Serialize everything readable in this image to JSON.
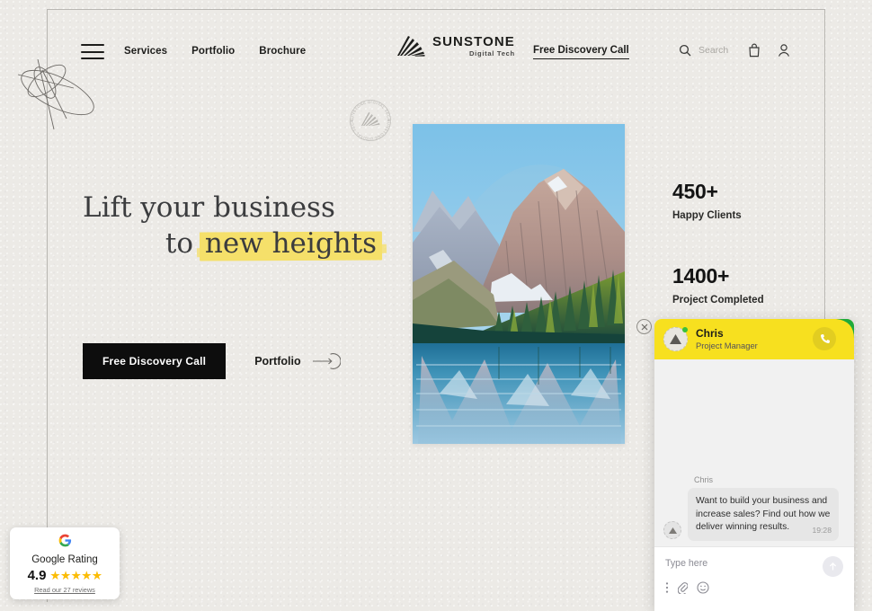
{
  "brand": {
    "name": "SUNSTONE",
    "tagline": "Digital Tech",
    "logo_icon": "sunburst-fan-icon",
    "stamp_text": "SUNSTONE DIGITAL TECH"
  },
  "colors": {
    "background": "#eceae6",
    "accent_yellow": "#f7e01f",
    "highlight_yellow": "#f5e06a",
    "ink": "#1d1d1b",
    "button_black": "#0d0d0d",
    "star_gold": "#fbbc05",
    "online_green": "#3ac13a"
  },
  "header": {
    "menu_icon": "hamburger-menu-icon",
    "nav": [
      {
        "label": "Services"
      },
      {
        "label": "Portfolio"
      },
      {
        "label": "Brochure"
      }
    ],
    "cta_label": "Free Discovery Call",
    "search": {
      "placeholder": "Search",
      "icon": "search-icon"
    },
    "bag_icon": "shopping-bag-icon",
    "account_icon": "user-account-icon"
  },
  "hero": {
    "line1": "Lift your business",
    "line2_prefix": "to ",
    "line2_highlight": "new heights",
    "primary_button": "Free Discovery Call",
    "secondary_link": "Portfolio",
    "secondary_icon": "arrow-right-circle-icon"
  },
  "stats": [
    {
      "value": "450+",
      "label": "Happy Clients"
    },
    {
      "value": "1400+",
      "label": "Project Completed"
    }
  ],
  "photo": {
    "alt": "mountain lake with forest reflection",
    "name": "hero-mountain-lake-photo"
  },
  "google_card": {
    "logo_icon": "google-g-icon",
    "title": "Google Rating",
    "score": "4.9",
    "stars": "★★★★★",
    "reviews_link": "Read our 27 reviews"
  },
  "chat": {
    "close_icon": "close-circle-icon",
    "agent_name": "Chris",
    "agent_role": "Project Manager",
    "avatar_icon": "mountain-avatar-icon",
    "status_icon": "online-status-dot",
    "call_icon": "phone-call-icon",
    "leaf_icon": "green-leaf-corner-icon",
    "message": {
      "sender": "Chris",
      "text": "Want to build your business and increase sales? Find out how we deliver winning results.",
      "time": "19:28"
    },
    "input_placeholder": "Type here",
    "send_icon": "send-arrow-up-icon",
    "toolbar": [
      {
        "icon": "more-options-dots-icon"
      },
      {
        "icon": "attachment-paperclip-icon"
      },
      {
        "icon": "emoji-smiley-icon"
      }
    ]
  },
  "decor": {
    "scribble": "hand-drawn-scribble-decoration"
  }
}
